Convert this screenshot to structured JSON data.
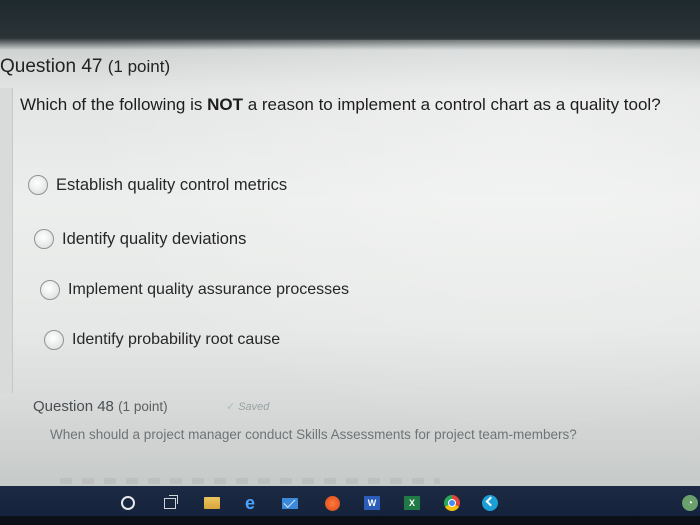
{
  "question47": {
    "label": "Question 47",
    "points": "(1 point)",
    "text_before": "Which of the following is ",
    "text_bold": "NOT",
    "text_after": " a reason to implement a control chart as a quality tool?",
    "options": [
      {
        "label": "Establish quality control metrics"
      },
      {
        "label": "Identify quality deviations"
      },
      {
        "label": "Implement quality assurance processes"
      },
      {
        "label": "Identify probability root cause"
      }
    ]
  },
  "question48": {
    "label": "Question 48",
    "points": "(1 point)",
    "status": "Saved",
    "text": "When should a project manager conduct Skills Assessments for project team-members?"
  },
  "taskbar": {
    "icons": [
      "cortana-icon",
      "task-view-icon",
      "file-explorer-icon",
      "edge-icon",
      "mail-icon",
      "media-icon",
      "word-icon",
      "excel-icon",
      "chrome-icon",
      "app-icon",
      "app-icon-right"
    ],
    "word_glyph": "W",
    "excel_glyph": "X",
    "edge_glyph": "e"
  }
}
